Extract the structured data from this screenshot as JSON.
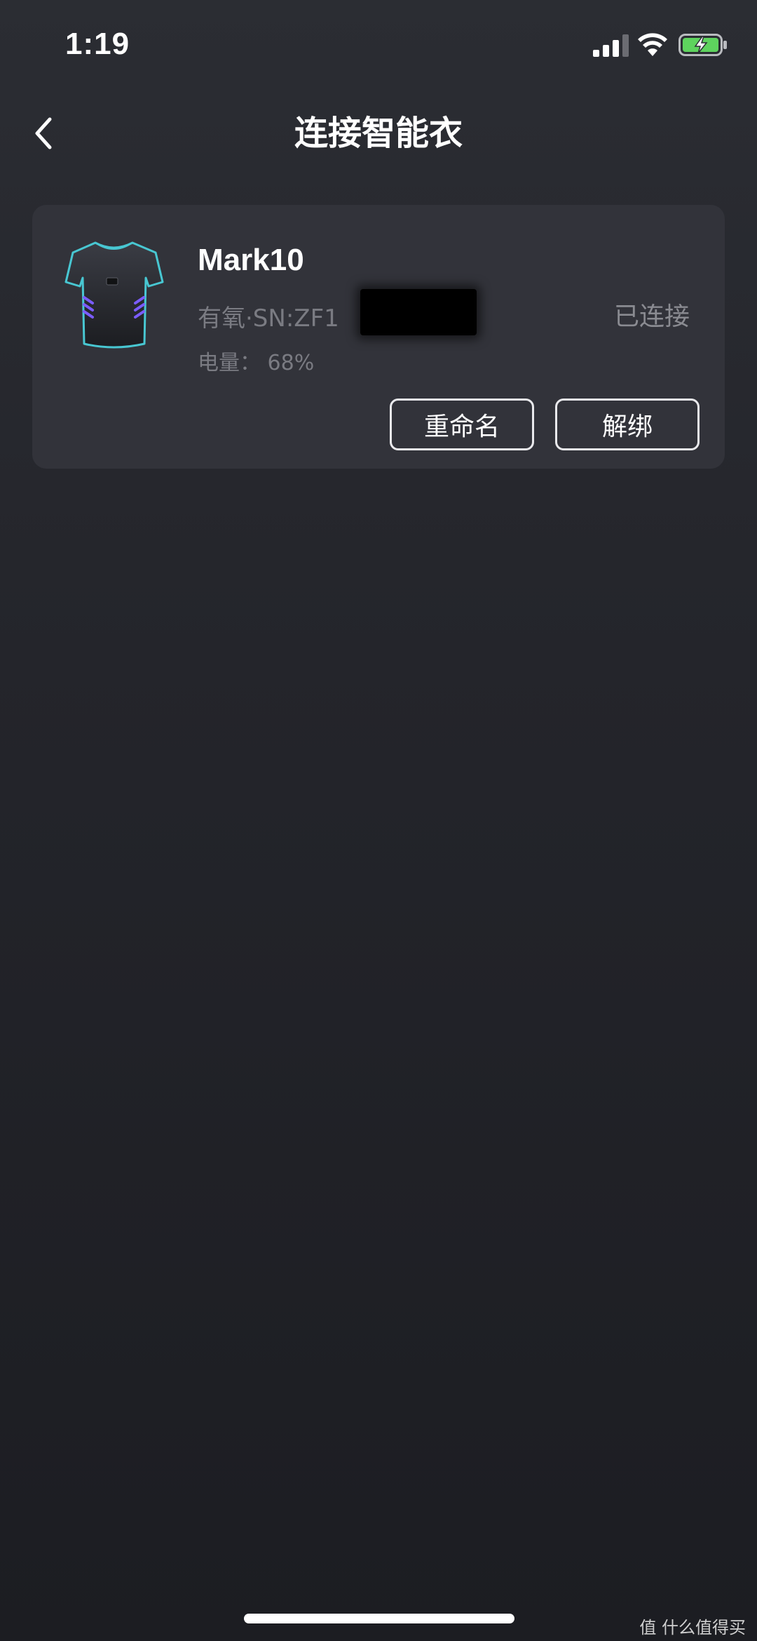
{
  "status_bar": {
    "time": "1:19",
    "signal_icon": "cellular-signal-icon",
    "wifi_icon": "wifi-icon",
    "battery_icon": "battery-charging-icon",
    "battery_color": "#5ed35e"
  },
  "nav": {
    "back_icon": "chevron-left-icon",
    "title": "连接智能衣"
  },
  "device_card": {
    "name": "Mark10",
    "info": "有氧·SN:ZF1",
    "status": "已连接",
    "battery": "电量： 68%",
    "rename_label": "重命名",
    "unbind_label": "解绑",
    "image_icon": "smart-shirt-image"
  },
  "watermark": "值 什么值得买"
}
